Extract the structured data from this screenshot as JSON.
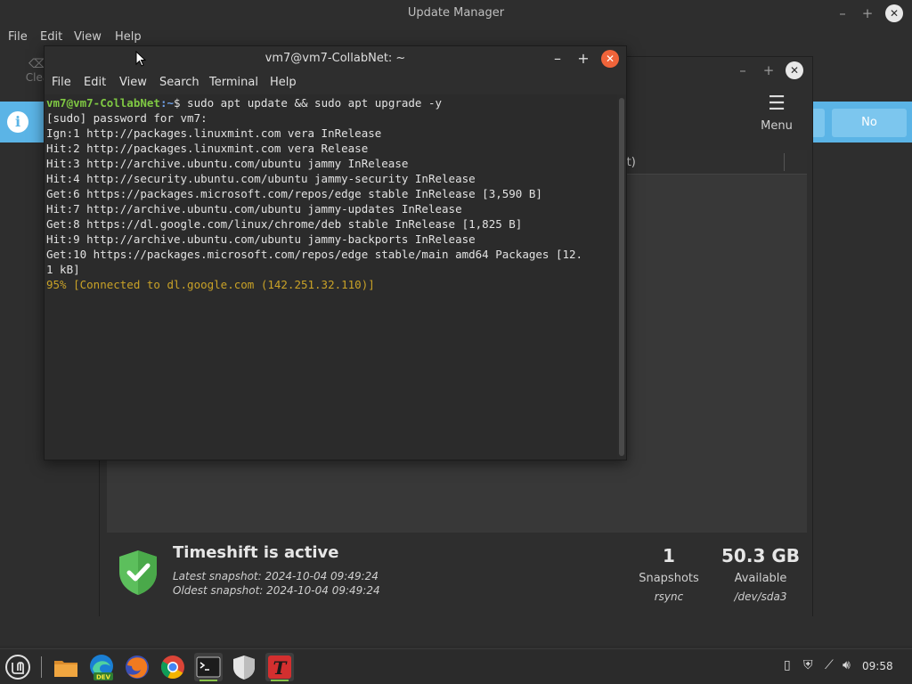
{
  "update_manager": {
    "title": "Update Manager",
    "menu": [
      "File",
      "Edit",
      "View",
      "Help"
    ],
    "clear_label": "Clea",
    "no_button": "No"
  },
  "timeshift": {
    "menu_label": "Menu",
    "column_label": "it)",
    "status_title": "Timeshift is active",
    "latest_snapshot": "Latest snapshot: 2024-10-04 09:49:24",
    "oldest_snapshot": "Oldest snapshot: 2024-10-04 09:49:24",
    "snapshots": {
      "value": "1",
      "label": "Snapshots",
      "sub": "rsync"
    },
    "available": {
      "value": "50.3 GB",
      "label": "Available",
      "sub": "/dev/sda3"
    }
  },
  "terminal": {
    "title": "vm7@vm7-CollabNet: ~",
    "menu": [
      "File",
      "Edit",
      "View",
      "Search",
      "Terminal",
      "Help"
    ],
    "prompt_user": "vm7@vm7-CollabNet",
    "prompt_path": ":~",
    "command": "$ sudo apt update && sudo apt upgrade -y",
    "lines": [
      "[sudo] password for vm7:",
      "Ign:1 http://packages.linuxmint.com vera InRelease",
      "Hit:2 http://packages.linuxmint.com vera Release",
      "Hit:3 http://archive.ubuntu.com/ubuntu jammy InRelease",
      "Hit:4 http://security.ubuntu.com/ubuntu jammy-security InRelease",
      "Get:6 https://packages.microsoft.com/repos/edge stable InRelease [3,590 B]",
      "Hit:7 http://archive.ubuntu.com/ubuntu jammy-updates InRelease",
      "Get:8 https://dl.google.com/linux/chrome/deb stable InRelease [1,825 B]",
      "Hit:9 http://archive.ubuntu.com/ubuntu jammy-backports InRelease",
      "Get:10 https://packages.microsoft.com/repos/edge stable/main amd64 Packages [12.",
      "1 kB]"
    ],
    "progress": "95% [Connected to dl.google.com (142.251.32.110)]"
  },
  "taskbar": {
    "apps": [
      "mint-menu-icon",
      "files-icon",
      "edge-dev-icon",
      "firefox-icon",
      "chrome-icon",
      "terminal-icon",
      "shield-icon",
      "text-editor-icon"
    ],
    "edge_badge": "DEV",
    "clock": "09:58"
  },
  "colors": {
    "accent_blue": "#5bb4e6",
    "prompt_green": "#7fc843",
    "progress_yellow": "#c9a227",
    "close_orange": "#f0643a"
  }
}
